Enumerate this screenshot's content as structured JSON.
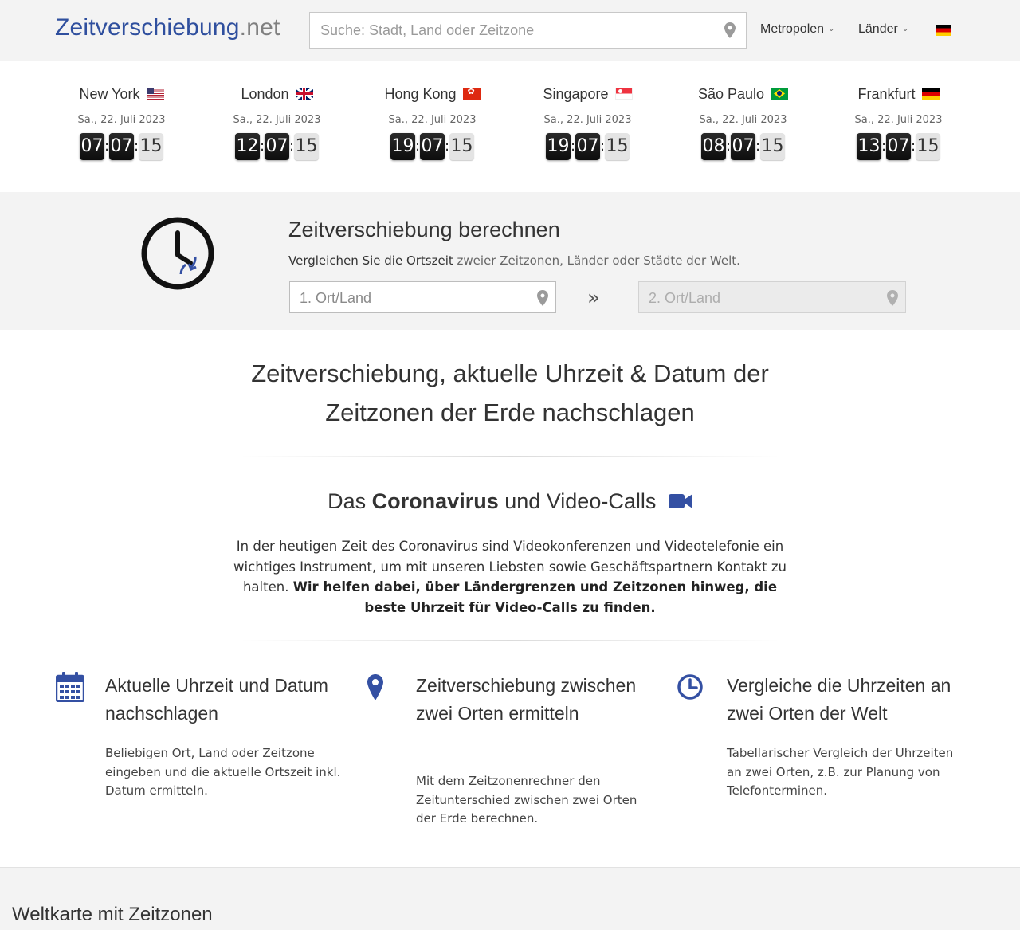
{
  "header": {
    "logo_brand": "Zeitverschiebung",
    "logo_tld": ".net",
    "search_placeholder": "Suche: Stadt, Land oder Zeitzone",
    "nav": [
      {
        "label": "Metropolen"
      },
      {
        "label": "Länder"
      }
    ],
    "language_flag": "flag-de-icon"
  },
  "clocks": [
    {
      "city": "New York",
      "flag": "flag-us-icon",
      "date": "Sa., 22. Juli 2023",
      "h": "07",
      "m": "07",
      "s": "15"
    },
    {
      "city": "London",
      "flag": "flag-uk-icon",
      "date": "Sa., 22. Juli 2023",
      "h": "12",
      "m": "07",
      "s": "15"
    },
    {
      "city": "Hong Kong",
      "flag": "flag-hk-icon",
      "date": "Sa., 22. Juli 2023",
      "h": "19",
      "m": "07",
      "s": "15"
    },
    {
      "city": "Singapore",
      "flag": "flag-sg-icon",
      "date": "Sa., 22. Juli 2023",
      "h": "19",
      "m": "07",
      "s": "15"
    },
    {
      "city": "São Paulo",
      "flag": "flag-br-icon",
      "date": "Sa., 22. Juli 2023",
      "h": "08",
      "m": "07",
      "s": "15"
    },
    {
      "city": "Frankfurt",
      "flag": "flag-de-icon",
      "date": "Sa., 22. Juli 2023",
      "h": "13",
      "m": "07",
      "s": "15"
    }
  ],
  "calculator": {
    "title": "Zeitverschiebung berechnen",
    "subtitle_main": "Vergleichen Sie die Ortszeit",
    "subtitle_muted": " zweier Zeitzonen, Länder oder Städte der Welt.",
    "place1_placeholder": "1. Ort/Land",
    "place2_placeholder": "2. Ort/Land",
    "arrow_glyph": "»"
  },
  "headline": {
    "line1": "Zeitverschiebung, aktuelle Uhrzeit & Datum der",
    "line2": "Zeitzonen der Erde nachschlagen"
  },
  "corona": {
    "title_pre": "Das ",
    "title_bold": "Coronavirus",
    "title_post": " und Video-Calls",
    "text_normal": "In der heutigen Zeit des Coronavirus sind Videokonferenzen und Videotelefonie ein wichtiges Instrument, um mit unseren Liebsten sowie Geschäftspartnern Kontakt zu halten. ",
    "text_bold": "Wir helfen dabei, über Ländergrenzen und Zeitzonen hinweg, die beste Uhrzeit für Video-Calls zu finden."
  },
  "features": [
    {
      "icon": "calendar-icon",
      "title": "Aktuelle Uhrzeit und Datum nachschlagen",
      "text": "Beliebigen Ort, Land oder Zeitzone eingeben und die aktuelle Ortszeit inkl. Datum ermitteln."
    },
    {
      "icon": "map-marker-icon",
      "title": "Zeitverschiebung zwischen zwei Orten ermitteln",
      "text": "Mit dem Zeitzonenrechner den Zeitunterschied zwischen zwei Orten der Erde berechnen."
    },
    {
      "icon": "clock-icon",
      "title": "Vergleiche die Uhrzeiten an zwei Orten der Welt",
      "text": "Tabellarischer Vergleich der Uhrzeiten an zwei Orten, z.B. zur Planung von Telefonterminen."
    }
  ],
  "world_map": {
    "title": "Weltkarte mit Zeitzonen"
  },
  "colors": {
    "brand_blue": "#2f4f9e",
    "icon_blue": "#3450a3",
    "band_gray": "#f3f3f3"
  }
}
